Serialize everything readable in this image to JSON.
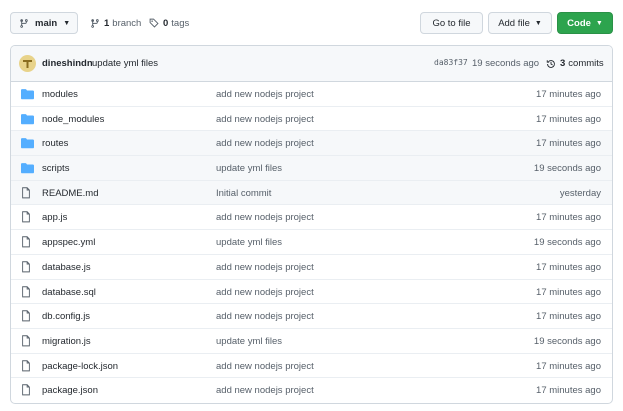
{
  "toolbar": {
    "branch_label": "main",
    "branches_count": "1",
    "branches_label": "branch",
    "tags_count": "0",
    "tags_label": "tags",
    "go_to_file": "Go to file",
    "add_file": "Add file",
    "code": "Code",
    "code_color": "#2da44e"
  },
  "commit": {
    "author": "dineshindn",
    "message": "update yml files",
    "sha": "da83f37",
    "time": "19 seconds ago",
    "commits_count": "3",
    "commits_label": "commits"
  },
  "files": [
    {
      "type": "folder",
      "name": "modules",
      "message": "add new nodejs project",
      "time": "17 minutes ago"
    },
    {
      "type": "folder",
      "name": "node_modules",
      "message": "add new nodejs project",
      "time": "17 minutes ago"
    },
    {
      "type": "folder",
      "name": "routes",
      "message": "add new nodejs project",
      "time": "17 minutes ago"
    },
    {
      "type": "folder",
      "name": "scripts",
      "message": "update yml files",
      "time": "19 seconds ago"
    },
    {
      "type": "file",
      "name": "README.md",
      "message": "Initial commit",
      "time": "yesterday"
    },
    {
      "type": "file",
      "name": "app.js",
      "message": "add new nodejs project",
      "time": "17 minutes ago"
    },
    {
      "type": "file",
      "name": "appspec.yml",
      "message": "update yml files",
      "time": "19 seconds ago"
    },
    {
      "type": "file",
      "name": "database.js",
      "message": "add new nodejs project",
      "time": "17 minutes ago"
    },
    {
      "type": "file",
      "name": "database.sql",
      "message": "add new nodejs project",
      "time": "17 minutes ago"
    },
    {
      "type": "file",
      "name": "db.config.js",
      "message": "add new nodejs project",
      "time": "17 minutes ago"
    },
    {
      "type": "file",
      "name": "migration.js",
      "message": "update yml files",
      "time": "19 seconds ago"
    },
    {
      "type": "file",
      "name": "package-lock.json",
      "message": "add new nodejs project",
      "time": "17 minutes ago"
    },
    {
      "type": "file",
      "name": "package.json",
      "message": "add new nodejs project",
      "time": "17 minutes ago"
    }
  ],
  "colors": {
    "folder_icon": "#54aeff",
    "file_icon": "#57606a"
  }
}
